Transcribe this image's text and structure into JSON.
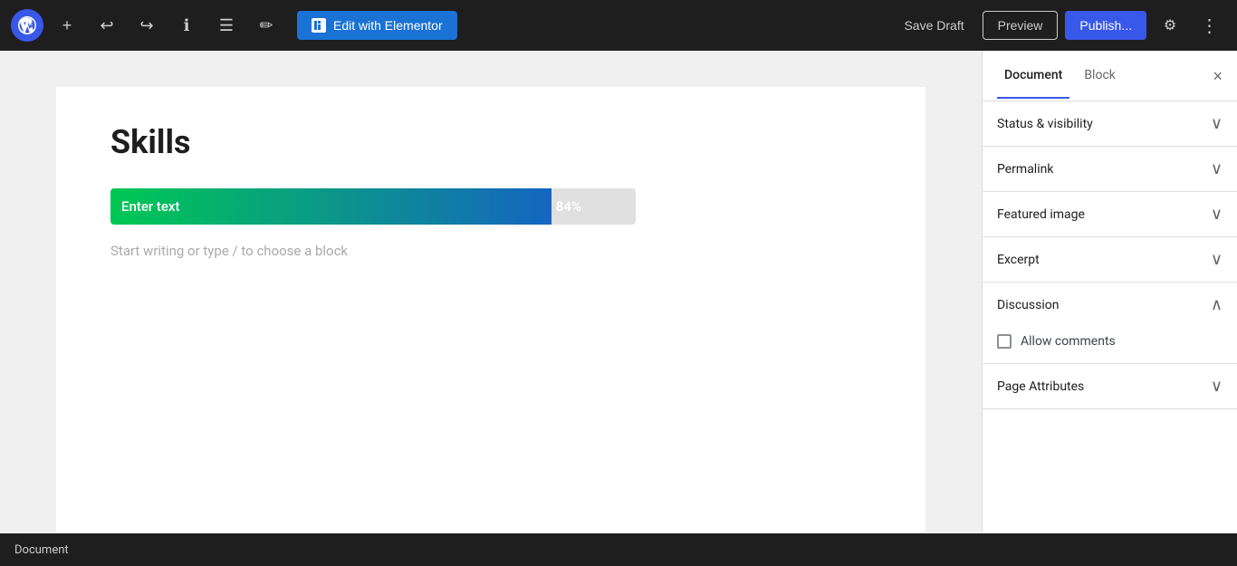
{
  "toolbar": {
    "add_label": "+",
    "undo_label": "↩",
    "redo_label": "↪",
    "info_label": "ℹ",
    "list_label": "☰",
    "edit_label": "✏",
    "edit_elementor_label": "Edit with Elementor",
    "save_draft_label": "Save Draft",
    "preview_label": "Preview",
    "publish_label": "Publish...",
    "settings_label": "⚙",
    "more_label": "⋮"
  },
  "sidebar": {
    "document_tab": "Document",
    "block_tab": "Block",
    "close_label": "×",
    "sections": [
      {
        "id": "status-visibility",
        "title": "Status & visibility",
        "expanded": false
      },
      {
        "id": "permalink",
        "title": "Permalink",
        "expanded": false
      },
      {
        "id": "featured-image",
        "title": "Featured image",
        "expanded": false
      },
      {
        "id": "excerpt",
        "title": "Excerpt",
        "expanded": false
      },
      {
        "id": "discussion",
        "title": "Discussion",
        "expanded": true
      },
      {
        "id": "page-attributes",
        "title": "Page Attributes",
        "expanded": false
      }
    ],
    "allow_comments_label": "Allow comments"
  },
  "canvas": {
    "post_title": "Skills",
    "progress_bar_text": "Enter text",
    "progress_bar_percent": "84%",
    "placeholder_text": "Start writing or type / to choose a block"
  },
  "bottom_bar": {
    "label": "Document"
  }
}
